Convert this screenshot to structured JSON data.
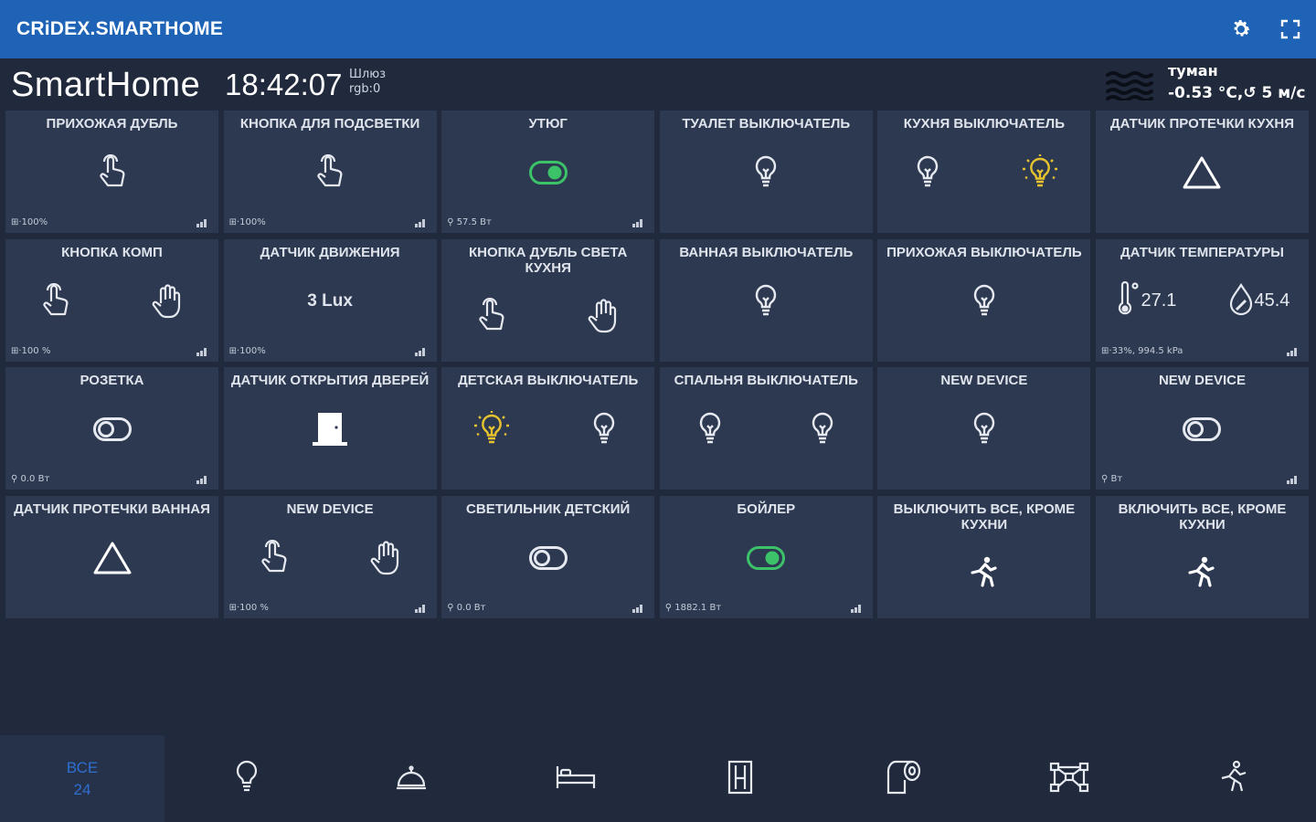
{
  "app": {
    "title": "CRiDEX.SMARTHOME"
  },
  "header": {
    "brand": "SmartHome",
    "time": "18:42:07",
    "gateway_line1": "Шлюз",
    "gateway_line2": "rgb:0",
    "weather_condition": "туман",
    "weather_value": "-0.53 °C,↺ 5 м/с"
  },
  "tiles": [
    {
      "name": "ПРИХОЖАЯ ДУБЛЬ",
      "footer": "⊞·100%",
      "icons": [
        "hand-tap-icon"
      ]
    },
    {
      "name": "КНОПКА ДЛЯ ПОДСВЕТКИ",
      "footer": "⊞·100%",
      "icons": [
        "hand-tap-icon"
      ]
    },
    {
      "name": "УТЮГ",
      "footer": "⚲ 57.5 Вт",
      "icons": [
        "toggle-on-icon"
      ]
    },
    {
      "name": "ТУАЛЕТ ВЫКЛЮЧАТЕЛЬ",
      "footer": "",
      "icons": [
        "bulb-off-icon"
      ]
    },
    {
      "name": "КУХНЯ ВЫКЛЮЧАТЕЛЬ",
      "footer": "",
      "icons": [
        "bulb-off-icon",
        "bulb-on-icon"
      ]
    },
    {
      "name": "ДАТЧИК ПРОТЕЧКИ КУХНЯ",
      "footer": "",
      "icons": [
        "warning-triangle-icon"
      ]
    },
    {
      "name": "КНОПКА КОМП",
      "footer": "⊞·100 %",
      "icons": [
        "hand-tap-icon",
        "hand-open-icon"
      ]
    },
    {
      "name": "ДАТЧИК ДВИЖЕНИЯ",
      "footer": "⊞·100%",
      "value": "3 Lux"
    },
    {
      "name": "КНОПКА ДУБЛЬ СВЕТА КУХНЯ",
      "footer": "",
      "icons": [
        "hand-tap-icon",
        "hand-open-icon"
      ]
    },
    {
      "name": "ВАННАЯ ВЫКЛЮЧАТЕЛЬ",
      "footer": "",
      "icons": [
        "bulb-off-icon"
      ]
    },
    {
      "name": "ПРИХОЖАЯ ВЫКЛЮЧАТЕЛЬ",
      "footer": "",
      "icons": [
        "bulb-off-icon"
      ]
    },
    {
      "name": "ДАТЧИК ТЕМПЕРАТУРЫ",
      "footer": "⊞·33%, 994.5 kPa",
      "temp": "27.1",
      "humidity": "45.4"
    },
    {
      "name": "РОЗЕТКА",
      "footer": "⚲ 0.0 Вт",
      "icons": [
        "toggle-off-icon"
      ]
    },
    {
      "name": "ДАТЧИК ОТКРЫТИЯ ДВЕРЕЙ",
      "footer": "",
      "icons": [
        "door-icon"
      ]
    },
    {
      "name": "ДЕТСКАЯ ВЫКЛЮЧАТЕЛЬ",
      "footer": "",
      "icons": [
        "bulb-on-icon",
        "bulb-off-icon"
      ]
    },
    {
      "name": "СПАЛЬНЯ ВЫКЛЮЧАТЕЛЬ",
      "footer": "",
      "icons": [
        "bulb-off-icon",
        "bulb-off-icon"
      ]
    },
    {
      "name": "NEW DEVICE",
      "footer": "",
      "icons": [
        "bulb-off-icon"
      ]
    },
    {
      "name": "NEW DEVICE",
      "footer": "⚲ Вт",
      "icons": [
        "toggle-off-icon"
      ]
    },
    {
      "name": "ДАТЧИК ПРОТЕЧКИ ВАННАЯ",
      "footer": "",
      "icons": [
        "warning-triangle-icon"
      ]
    },
    {
      "name": "NEW DEVICE",
      "footer": "⊞·100 %",
      "icons": [
        "hand-tap-icon",
        "hand-open-icon"
      ]
    },
    {
      "name": "СВЕТИЛЬНИК ДЕТСКИЙ",
      "footer": "⚲ 0.0 Вт",
      "icons": [
        "toggle-off-icon"
      ]
    },
    {
      "name": "БОЙЛЕР",
      "footer": "⚲ 1882.1 Вт",
      "icons": [
        "toggle-on-icon"
      ]
    },
    {
      "name": "ВЫКЛЮЧИТЬ ВСЕ, КРОМЕ КУХНИ",
      "footer": "",
      "icons": [
        "running-man-icon"
      ]
    },
    {
      "name": "ВКЛЮЧИТЬ ВСЕ, КРОМЕ КУХНИ",
      "footer": "",
      "icons": [
        "running-man-icon"
      ]
    }
  ],
  "bottom_nav": {
    "all_label": "ВСЕ",
    "all_count": "24",
    "tabs": [
      "bulb-icon",
      "service-bell-icon",
      "bed-icon",
      "door-panel-icon",
      "toilet-paper-icon",
      "network-icon",
      "motion-icon"
    ]
  },
  "colors": {
    "appbar": "#1e63b5",
    "tile": "#2d3951",
    "background": "#202a3c",
    "accent_on": "#3cc36a",
    "bulb_on": "#e6c22f",
    "tab_active": "#2e6fd0"
  }
}
